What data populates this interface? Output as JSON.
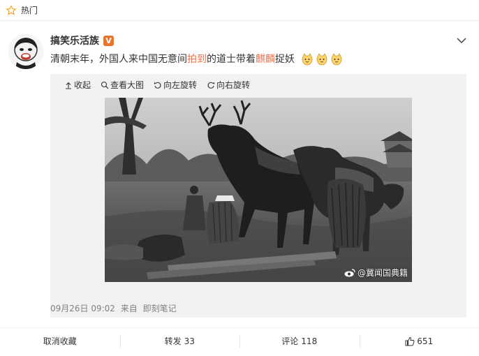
{
  "hotbar": {
    "label": "热门",
    "icon": "star-icon"
  },
  "post": {
    "author": "搞笑乐活族",
    "verified_badge": "V",
    "text_parts": {
      "p1": "清朝末年，外国人来中国无意间",
      "hl1": "拍到",
      "p2": "的道士带着",
      "hl2": "麒麟",
      "p3": "捉妖"
    },
    "emoji_count": 3,
    "highlight_color": "#eb7350",
    "tools": {
      "collapse": "收起",
      "view_large": "查看大图",
      "rotate_left": "向左旋转",
      "rotate_right": "向右旋转"
    },
    "watermark": "@冀闻国典籍",
    "timestamp": "09月26日 09:02",
    "source_prefix": "来自",
    "source": "即刻笔记"
  },
  "actions": {
    "uncollect": "取消收藏",
    "repost": "转发",
    "repost_count": "33",
    "comment": "评论",
    "comment_count": "118",
    "like_count": "651"
  }
}
